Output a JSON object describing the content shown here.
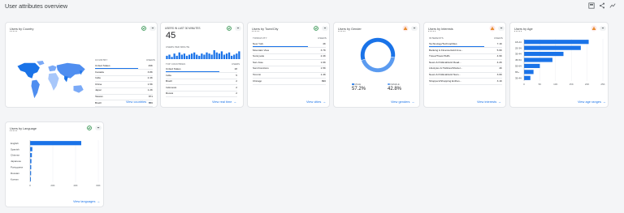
{
  "page": {
    "title": "User attributes overview"
  },
  "colors": {
    "accent": "#1a73e8",
    "ok": "#188038",
    "warn": "#e37400"
  },
  "country": {
    "title_prefix": "Users",
    "title_suffix": " by Country",
    "col_label": "COUNTRY",
    "col_value": "USERS",
    "rows": [
      {
        "name": "United States",
        "value": "49K"
      },
      {
        "name": "Canada",
        "value": "3.8K"
      },
      {
        "name": "India",
        "value": "2.4K"
      },
      {
        "name": "China",
        "value": "1.5K"
      },
      {
        "name": "Japan",
        "value": "1.2K"
      },
      {
        "name": "Taiwan",
        "value": "871"
      },
      {
        "name": "Brazil",
        "value": "836"
      }
    ],
    "link": "View countries"
  },
  "realtime": {
    "title": "USERS IN LAST 30 MINUTES",
    "count": "45",
    "per_minute": "USERS PER MINUTE",
    "bars": [
      3,
      4,
      2,
      5,
      3,
      6,
      4,
      5,
      3,
      4,
      5,
      6,
      4,
      3,
      5,
      4,
      6,
      5,
      4,
      8,
      6,
      5,
      7,
      4,
      5,
      6,
      3,
      4,
      5,
      7
    ],
    "col_label": "TOP COUNTRIES",
    "col_value": "USERS",
    "rows": [
      {
        "name": "United States",
        "value": "18"
      },
      {
        "name": "India",
        "value": "5"
      },
      {
        "name": "Brazil",
        "value": "2"
      },
      {
        "name": "Indonesia",
        "value": "2"
      },
      {
        "name": "Russia",
        "value": "2"
      }
    ],
    "link": "View real time"
  },
  "city": {
    "title_prefix": "Users",
    "title_suffix": " by Town/City",
    "col_label": "TOWN/CITY",
    "col_value": "USERS",
    "rows": [
      {
        "name": "New York",
        "value": "4K"
      },
      {
        "name": "Mountain View",
        "value": "3.7K"
      },
      {
        "name": "Sunnyvale",
        "value": "2.4K"
      },
      {
        "name": "San Jose",
        "value": "1.6K"
      },
      {
        "name": "San Francisco",
        "value": "1.5K"
      },
      {
        "name": "Toronto",
        "value": "1.4K"
      },
      {
        "name": "Chicago",
        "value": "896"
      }
    ],
    "link": "View cities"
  },
  "gender": {
    "title_prefix": "Users",
    "title_suffix": " by Gender",
    "legend": [
      {
        "name": "MALE",
        "value": "57.2%",
        "color": "#1a73e8"
      },
      {
        "name": "FEMALE",
        "value": "42.8%",
        "color": "#5b9bf0"
      }
    ],
    "link": "View genders"
  },
  "interests": {
    "title_prefix": "Users",
    "title_suffix": " by Interests",
    "col_label": "INTERESTS",
    "col_value": "USERS",
    "rows": [
      {
        "name": "Technology/Technophiles",
        "value": "7.1K"
      },
      {
        "name": "Banking & Finance/Avid Inve...",
        "value": "5.6K"
      },
      {
        "name": "Travel/Travel Buffs",
        "value": "4.9K"
      },
      {
        "name": "News & Political/Avid Read...",
        "value": "4.2K"
      },
      {
        "name": "Lifestyles & Hobbies/Shutter...",
        "value": "4K"
      },
      {
        "name": "News & Political/Avid Nam...",
        "value": "3.6K"
      },
      {
        "name": "Shoppers/Shopping Enthus...",
        "value": "3.1K"
      }
    ],
    "link": "View interests"
  },
  "age": {
    "title_prefix": "Users",
    "title_suffix": " by Age",
    "link": "View age ranges"
  },
  "language": {
    "title_prefix": "Users",
    "title_suffix": " by Language",
    "link": "View languages"
  },
  "chart_data": [
    {
      "type": "bar",
      "orientation": "horizontal",
      "title": "Users by Age",
      "categories": [
        "18-24",
        "25-34",
        "35-44",
        "45-54",
        "55-64",
        "65+",
        "35-44"
      ],
      "values": [
        20.5,
        18,
        12.5,
        9,
        5,
        3,
        2
      ],
      "xticks": [
        "0",
        "5K",
        "10K",
        "15K",
        "20K",
        "25K"
      ],
      "xlim": [
        0,
        25
      ]
    },
    {
      "type": "bar",
      "orientation": "horizontal",
      "title": "Users by Language",
      "categories": [
        "English",
        "Spanish",
        "Chinese",
        "Japanese",
        "Portuguese",
        "Russian",
        "Korean"
      ],
      "values": [
        45,
        2,
        1.6,
        1.2,
        1,
        0.9,
        0.7
      ],
      "xticks": [
        "0",
        "20K",
        "40K",
        "60K"
      ],
      "xlim": [
        0,
        60
      ]
    }
  ]
}
